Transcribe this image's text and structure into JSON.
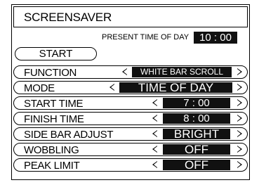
{
  "title": "SCREENSAVER",
  "present_time": {
    "label": "PRESENT TIME OF DAY",
    "value": "10 : 00"
  },
  "start_label": "START",
  "rows": [
    {
      "label": "FUNCTION",
      "value": "WHITE BAR SCROLL"
    },
    {
      "label": "MODE",
      "value": "TIME OF DAY"
    },
    {
      "label": "START TIME",
      "value": "7 : 00"
    },
    {
      "label": "FINISH TIME",
      "value": "8 : 00"
    },
    {
      "label": "SIDE BAR ADJUST",
      "value": "BRIGHT"
    },
    {
      "label": "WOBBLING",
      "value": "OFF"
    },
    {
      "label": "PEAK LIMIT",
      "value": "OFF"
    }
  ]
}
